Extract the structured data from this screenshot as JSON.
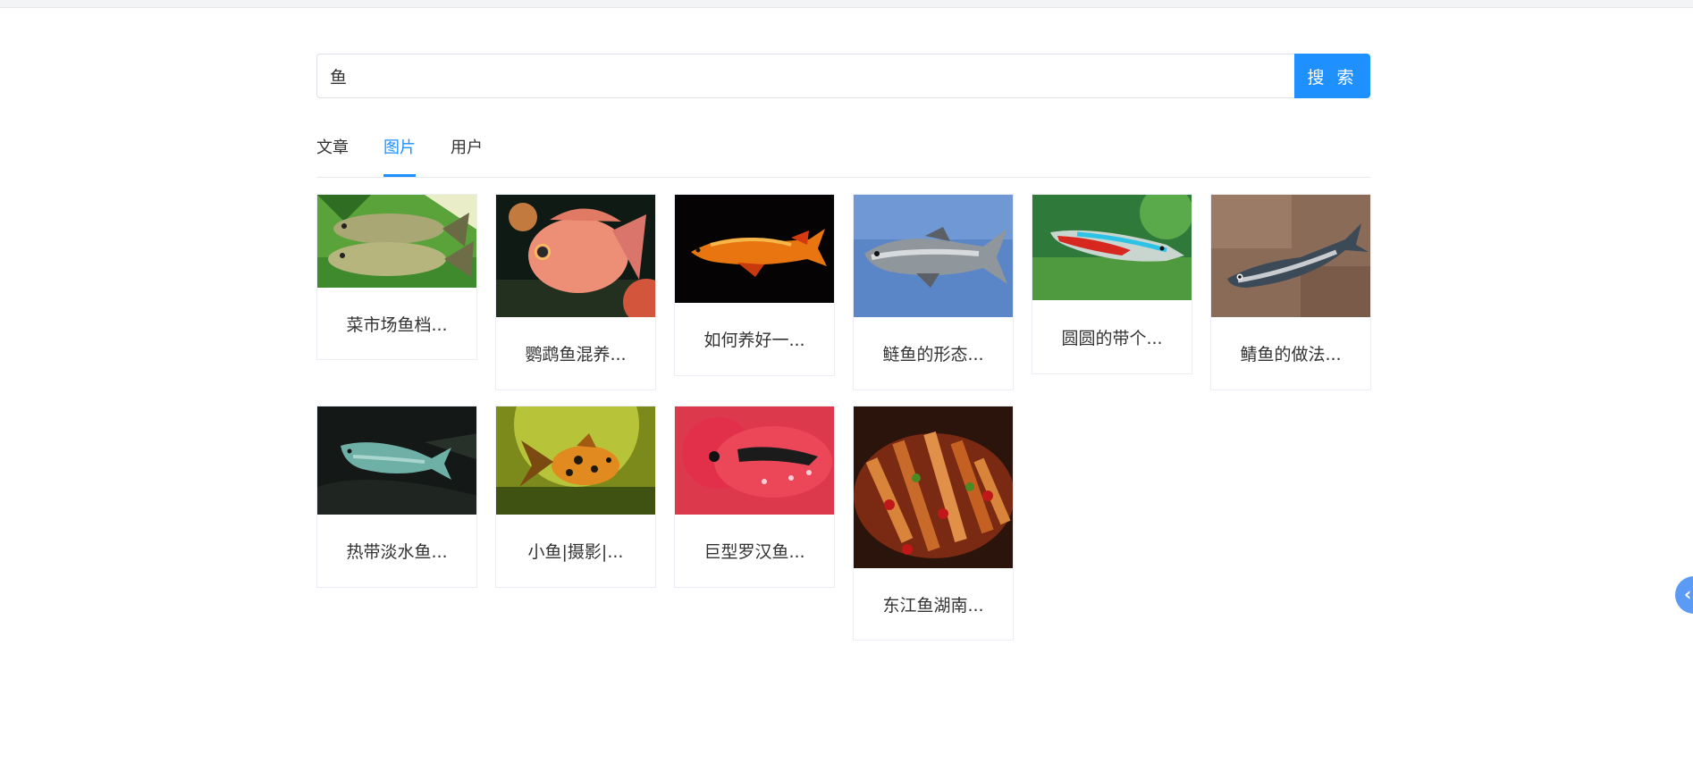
{
  "search": {
    "value": "鱼",
    "button_label": "搜 索"
  },
  "tabs": [
    {
      "label": "文章",
      "active": false
    },
    {
      "label": "图片",
      "active": true
    },
    {
      "label": "用户",
      "active": false
    }
  ],
  "results": [
    {
      "caption": "菜市场鱼档..."
    },
    {
      "caption": "鹦鹉鱼混养..."
    },
    {
      "caption": "如何养好一..."
    },
    {
      "caption": "鲢鱼的形态..."
    },
    {
      "caption": "圆圆的带个..."
    },
    {
      "caption": "鲭鱼的做法..."
    },
    {
      "caption": "热带淡水鱼..."
    },
    {
      "caption": "小鱼|摄影|..."
    },
    {
      "caption": "巨型罗汉鱼..."
    },
    {
      "caption": "东江鱼湖南..."
    }
  ],
  "colors": {
    "accent": "#1e90ff",
    "side_handle": "#5c9bf5"
  }
}
